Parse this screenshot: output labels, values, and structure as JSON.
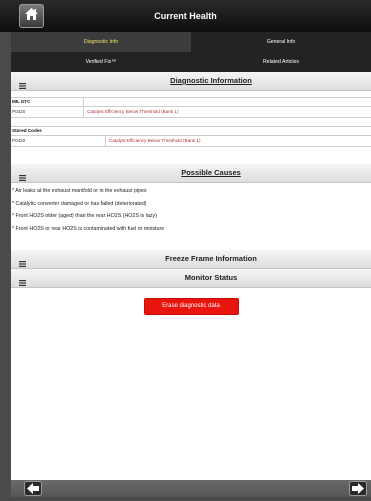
{
  "header": {
    "title": "Current Health",
    "home_icon": "home-icon"
  },
  "tabs": [
    {
      "label": "Diagnostic Info",
      "active": true
    },
    {
      "label": "General Info",
      "active": false
    },
    {
      "label": "Verified Fix™",
      "active": false
    },
    {
      "label": "Related Articles",
      "active": false
    }
  ],
  "diagnostic": {
    "title": "Diagnostic Information",
    "mil_label": "MIL DTC",
    "mil_rows": [
      {
        "code": "P0420",
        "description": "Catalyst Efficiency Below Threshold (Bank 1)"
      }
    ],
    "stored_label": "Stored Codes",
    "stored_rows": [
      {
        "code": "P0420",
        "description": "Catalyst Efficiency Below Threshold (Bank 1)"
      }
    ]
  },
  "causes": {
    "title": "Possible Causes",
    "items": [
      "* Air leaks at the exhaust manifold or in the exhaust pipes",
      "* Catalytic converter damaged or has failed (deteriorated)",
      "* Front HO2S older (aged) than the rear HO2S (HO2S is lazy)",
      "* Front HO2S or rear HO2S is contaminated with fuel or moisture"
    ]
  },
  "freeze_frame": {
    "title": "Freeze Frame Information"
  },
  "monitor": {
    "title": "Monitor Status"
  },
  "erase_button": "Erase diagnostic data",
  "colors": {
    "accent_tab": "#f0e16a",
    "erase": "#e8150e",
    "dtc_text": "#b03030"
  }
}
